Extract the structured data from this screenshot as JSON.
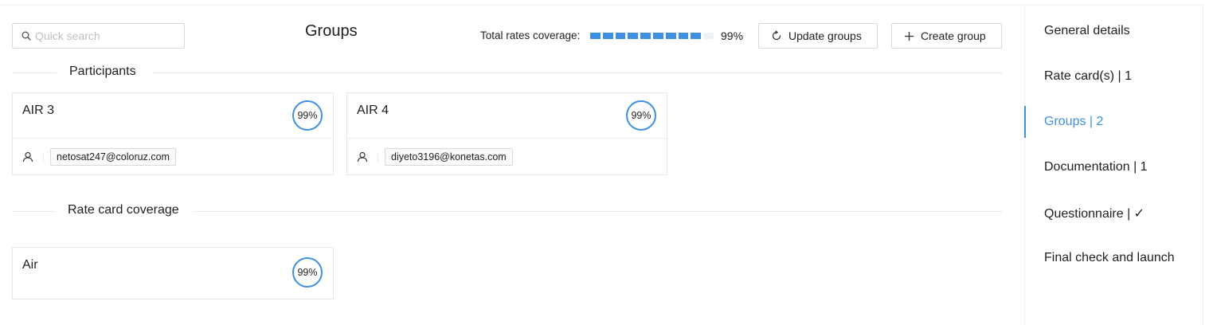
{
  "header": {
    "search_placeholder": "Quick search",
    "title": "Groups",
    "coverage_label": "Total rates coverage:",
    "coverage_value": "99%",
    "coverage_fraction": 0.99,
    "update_button": "Update groups",
    "create_button": "Create group"
  },
  "sections": {
    "participants_label": "Participants",
    "rate_card_label": "Rate card coverage"
  },
  "participants": [
    {
      "name": "AIR 3",
      "coverage": "99%",
      "email": "netosat247@coloruz.com"
    },
    {
      "name": "AIR 4",
      "coverage": "99%",
      "email": "diyeto3196@konetas.com"
    }
  ],
  "rate_cards": [
    {
      "name": "Air",
      "coverage": "99%"
    }
  ],
  "sidebar": {
    "items": [
      {
        "label": "General details"
      },
      {
        "label": "Rate card(s) | 1"
      },
      {
        "label": "Groups | 2",
        "active": true
      },
      {
        "label": "Documentation | 1"
      },
      {
        "label": "Questionnaire | ✓"
      },
      {
        "label": "Final check and launch"
      }
    ]
  },
  "colors": {
    "accent": "#3d8fe8",
    "border": "#d9d9d9"
  },
  "icons": [
    "search-icon",
    "reload-icon",
    "plus-icon",
    "user-icon"
  ]
}
